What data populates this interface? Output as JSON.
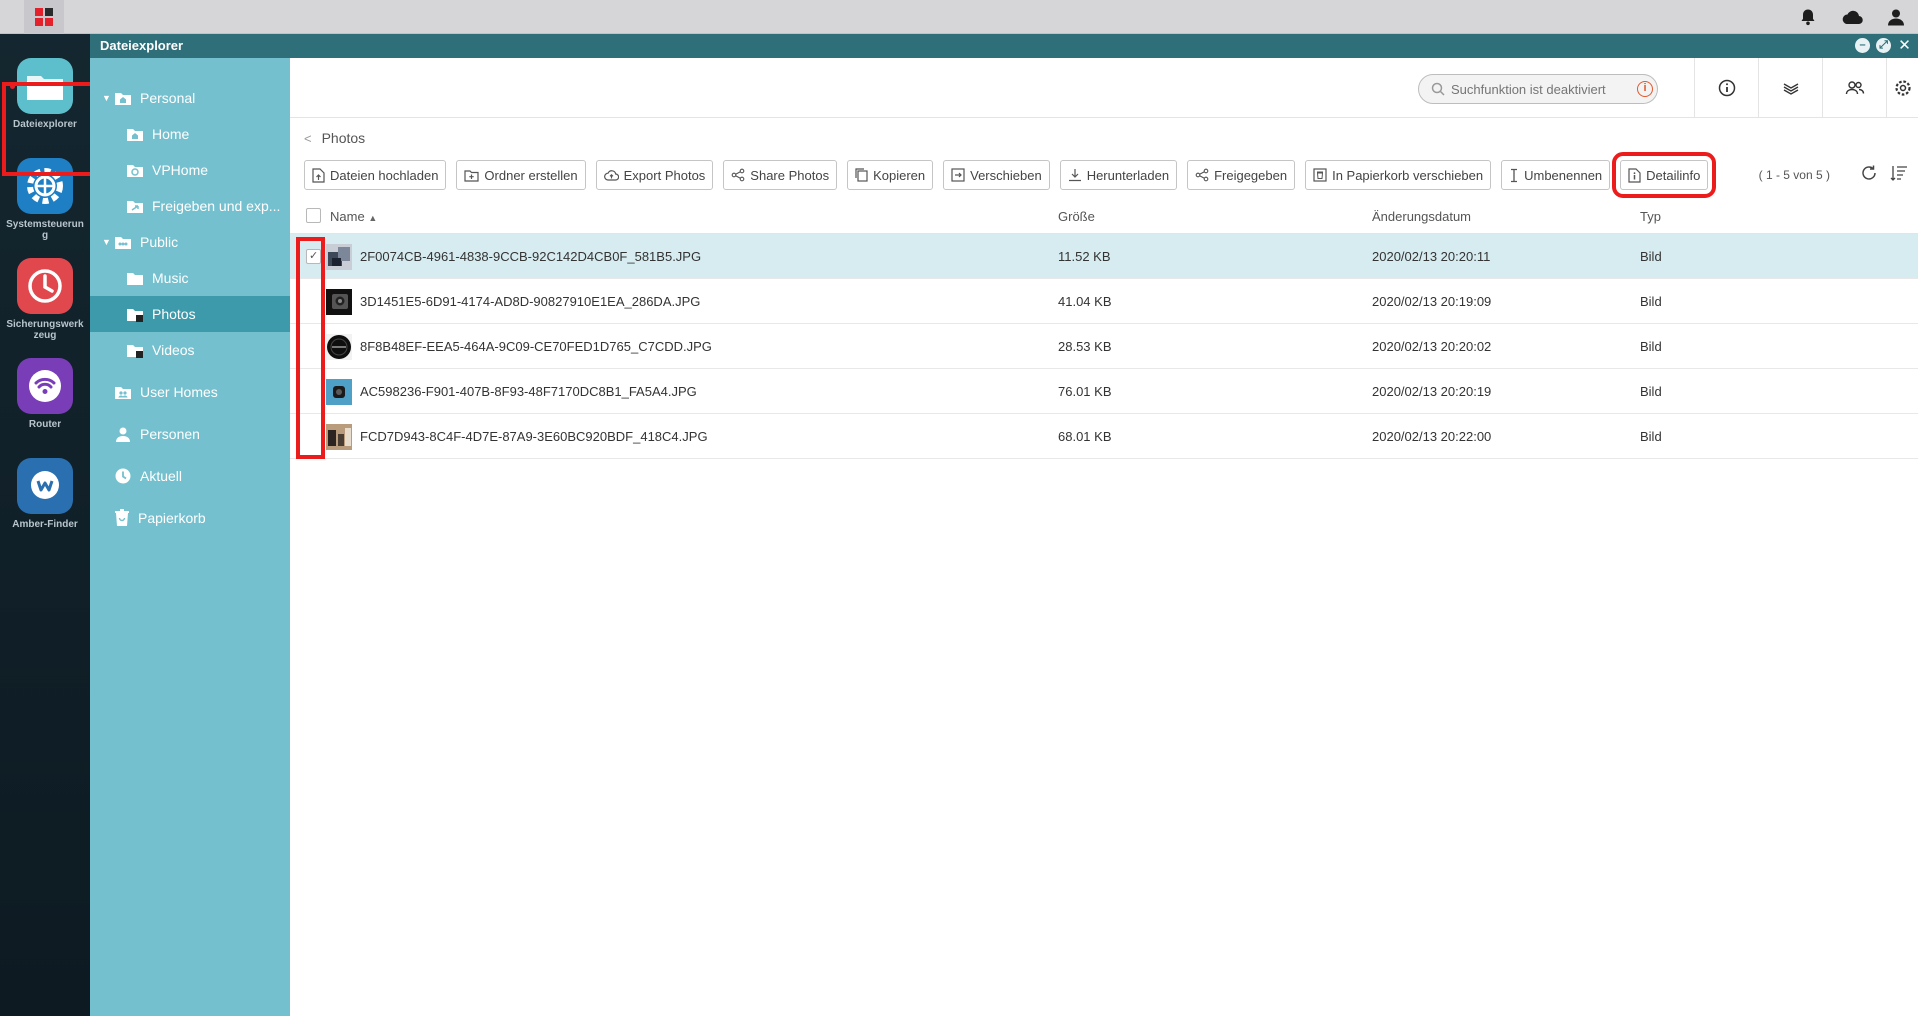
{
  "window": {
    "title": "Dateiexplorer"
  },
  "dock": [
    {
      "label": "Dateiexplorer",
      "icon": "folder-icon",
      "color": "#5ebfcc"
    },
    {
      "label": "Systemsteuerung",
      "icon": "gear-icon",
      "color": "#1f7fc4"
    },
    {
      "label": "Sicherungswerkzeug",
      "icon": "clock-icon",
      "color": "#e0484e"
    },
    {
      "label": "Router",
      "icon": "wifi-icon",
      "color": "#7a3db8"
    },
    {
      "label": "Amber-Finder",
      "icon": "finder-icon",
      "color": "#2a6fb0"
    }
  ],
  "tree": [
    {
      "label": "Personal",
      "icon": "home-folder-icon"
    },
    {
      "label": "Home",
      "icon": "home-folder-icon"
    },
    {
      "label": "VPHome",
      "icon": "vp-folder-icon"
    },
    {
      "label": "Freigeben und exp...",
      "icon": "share-folder-icon"
    },
    {
      "label": "Public",
      "icon": "public-folder-icon"
    },
    {
      "label": "Music",
      "icon": "folder-icon"
    },
    {
      "label": "Photos",
      "icon": "folder-icon"
    },
    {
      "label": "Videos",
      "icon": "folder-icon"
    },
    {
      "label": "User Homes",
      "icon": "users-folder-icon"
    },
    {
      "label": "Personen",
      "icon": "person-icon"
    },
    {
      "label": "Aktuell",
      "icon": "clock-icon"
    },
    {
      "label": "Papierkorb",
      "icon": "trash-icon"
    }
  ],
  "search": {
    "placeholder": "Suchfunktion ist deaktiviert"
  },
  "breadcrumb": {
    "current": "Photos"
  },
  "toolbar": {
    "upload": "Dateien hochladen",
    "new_folder": "Ordner erstellen",
    "export": "Export Photos",
    "share": "Share Photos",
    "copy": "Kopieren",
    "move": "Verschieben",
    "download": "Herunterladen",
    "shared": "Freigegeben",
    "trash": "In Papierkorb verschieben",
    "rename": "Umbenennen",
    "details": "Detailinfo"
  },
  "pager": "( 1 - 5 von 5 )",
  "columns": {
    "name": "Name",
    "size": "Größe",
    "date": "Änderungsdatum",
    "type": "Typ"
  },
  "files": [
    {
      "name": "2F0074CB-4961-4838-9CCB-92C142D4CB0F_581B5.JPG",
      "size": "11.52 KB",
      "date": "2020/02/13 20:20:11",
      "type": "Bild",
      "selected": true
    },
    {
      "name": "3D1451E5-6D91-4174-AD8D-90827910E1EA_286DA.JPG",
      "size": "41.04 KB",
      "date": "2020/02/13 20:19:09",
      "type": "Bild",
      "selected": false
    },
    {
      "name": "8F8B48EF-EEA5-464A-9C09-CE70FED1D765_C7CDD.JPG",
      "size": "28.53 KB",
      "date": "2020/02/13 20:20:02",
      "type": "Bild",
      "selected": false
    },
    {
      "name": "AC598236-F901-407B-8F93-48F7170DC8B1_FA5A4.JPG",
      "size": "76.01 KB",
      "date": "2020/02/13 20:20:19",
      "type": "Bild",
      "selected": false
    },
    {
      "name": "FCD7D943-8C4F-4D7E-87A9-3E60BC920BDF_418C4.JPG",
      "size": "68.01 KB",
      "date": "2020/02/13 20:22:00",
      "type": "Bild",
      "selected": false
    }
  ]
}
